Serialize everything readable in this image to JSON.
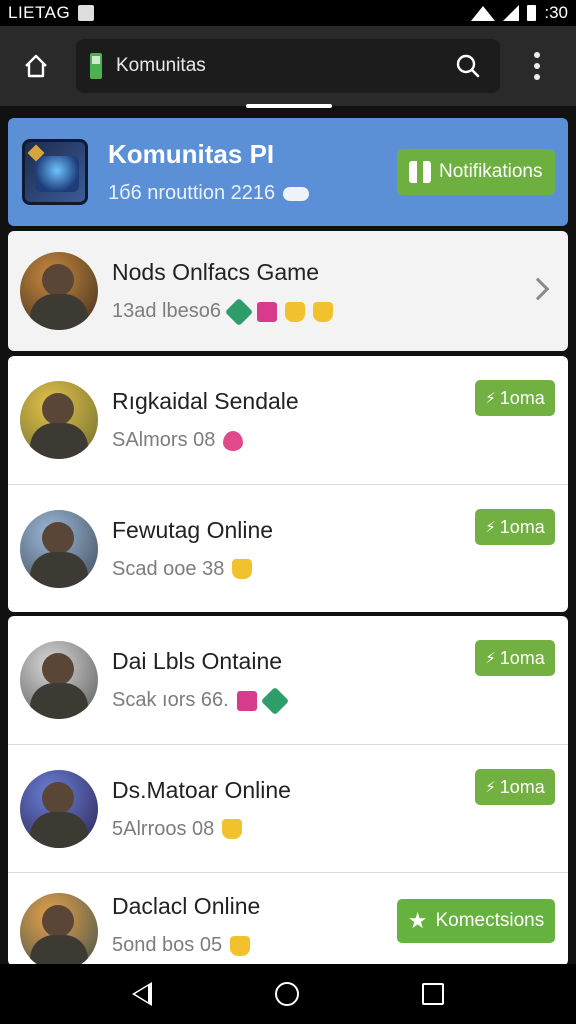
{
  "status_bar": {
    "left_text": "LIETAG",
    "time": ":30"
  },
  "browser": {
    "url_text": "Komunitas"
  },
  "community": {
    "title": "Komunitas PI",
    "subtitle": "1б6  nrouttion 2216",
    "notify_label": "Notifikations"
  },
  "rows": [
    {
      "title": "Nods Onlfacs Game",
      "sub": "13ad lbeso6"
    },
    {
      "title": "Rıgkaidal Sendale",
      "sub": "SAlmors 08",
      "btn": "1oma"
    },
    {
      "title": "Fewutag Online",
      "sub": "Scad ooe 38",
      "btn": "1oma"
    },
    {
      "title": "Dai Lbls Ontaine",
      "sub": "Scak ıors 66.",
      "btn": "1oma"
    },
    {
      "title": "Ds.Matoar Online",
      "sub": "5Alrroos 08",
      "btn": "1oma"
    },
    {
      "title": "Daclacl Online",
      "sub": "5ond bos 05",
      "btn": "Komectsions"
    }
  ],
  "icons": {
    "home": "home-icon",
    "search": "search-icon",
    "menu": "more-vert-icon",
    "nav_back": "back-icon",
    "nav_home": "home-circle-icon",
    "nav_recent": "recent-apps-icon"
  },
  "colors": {
    "header_blue": "#5b8fd6",
    "accent_green": "#72b041",
    "browser_bar": "#2a2a2a"
  }
}
